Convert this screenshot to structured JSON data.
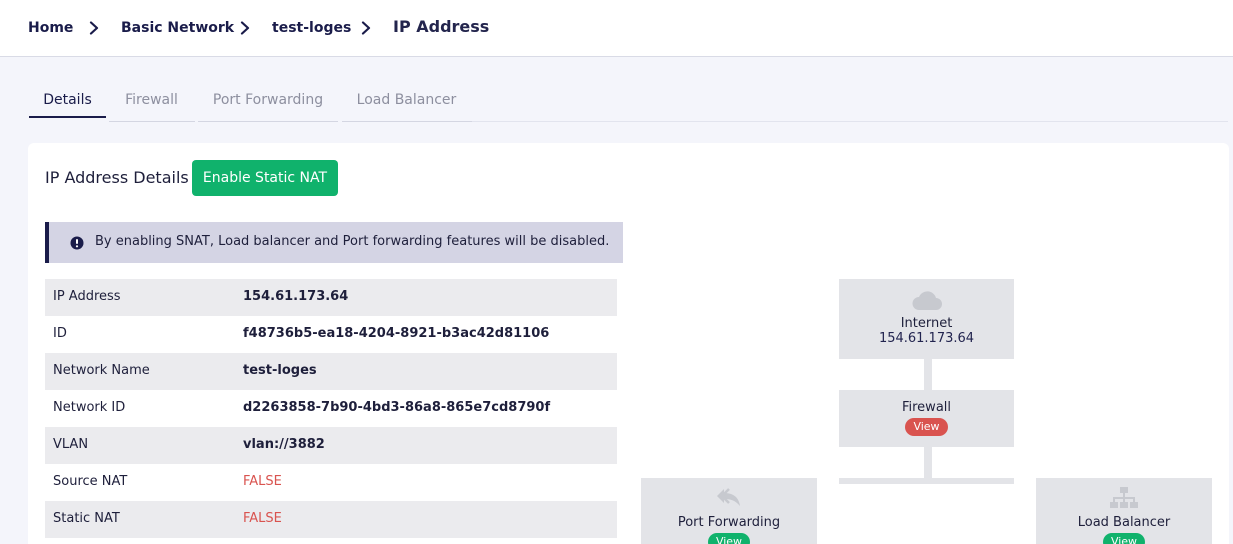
{
  "breadcrumb": {
    "items": [
      "Home",
      "Basic Network",
      "test-loges",
      "IP Address"
    ]
  },
  "tabs": [
    "Details",
    "Firewall",
    "Port Forwarding",
    "Load Balancer"
  ],
  "panel": {
    "title": "IP Address Details",
    "enable_static_nat_label": "Enable Static NAT",
    "alert": "By enabling SNAT, Load balancer and Port forwarding features will be disabled."
  },
  "details": [
    {
      "label": "IP Address",
      "value": "154.61.173.64"
    },
    {
      "label": "ID",
      "value": "f48736b5-ea18-4204-8921-b3ac42d81106"
    },
    {
      "label": "Network Name",
      "value": "test-loges"
    },
    {
      "label": "Network ID",
      "value": "d2263858-7b90-4bd3-86a8-865e7cd8790f"
    },
    {
      "label": "VLAN",
      "value": "vlan://3882"
    },
    {
      "label": "Source NAT",
      "value": "FALSE"
    },
    {
      "label": "Static NAT",
      "value": "FALSE"
    }
  ],
  "diagram": {
    "internet": {
      "label": "Internet",
      "ip": "154.61.173.64"
    },
    "firewall": {
      "label": "Firewall",
      "view": "View"
    },
    "port_forwarding": {
      "label": "Port Forwarding",
      "view": "View"
    },
    "load_balancer": {
      "label": "Load Balancer",
      "view": "View"
    }
  },
  "colors": {
    "primary": "#1a1c4a",
    "success": "#10b26c",
    "danger": "#d9534f",
    "alert_bg": "#d4d4e4"
  },
  "icons": [
    "chevron-right-icon",
    "exclamation-circle-icon",
    "cloud-icon",
    "reply-arrow-icon",
    "sitemap-icon"
  ]
}
